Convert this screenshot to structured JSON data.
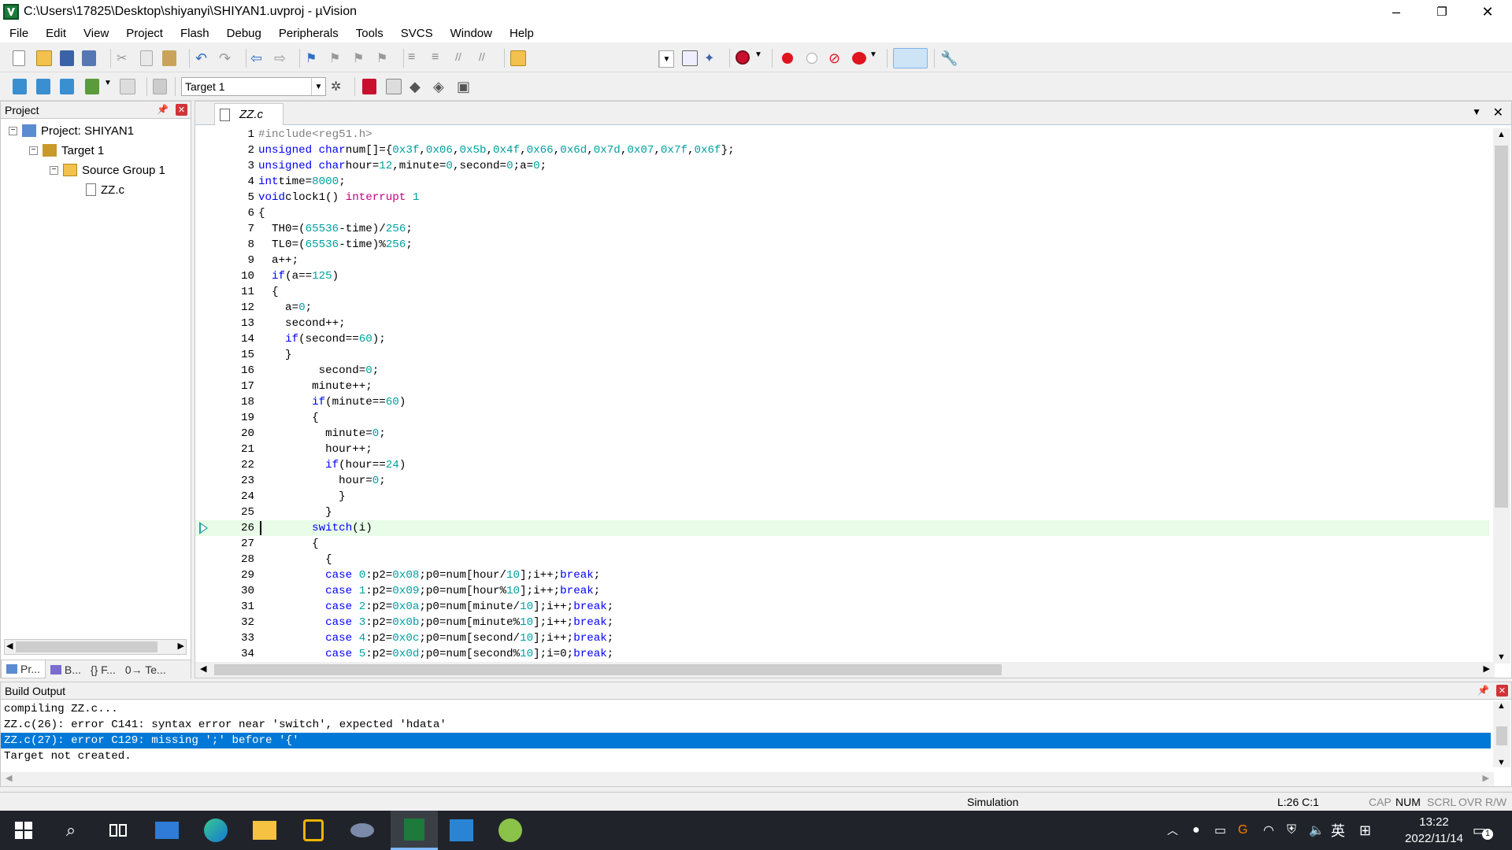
{
  "window": {
    "title": "C:\\Users\\17825\\Desktop\\shiyanyi\\SHIYAN1.uvproj - µVision",
    "minimize": "–",
    "restore": "❐",
    "close": "✕"
  },
  "menu": [
    "File",
    "Edit",
    "View",
    "Project",
    "Flash",
    "Debug",
    "Peripherals",
    "Tools",
    "SVCS",
    "Window",
    "Help"
  ],
  "toolbar": {
    "target_select": "Target 1"
  },
  "project_panel": {
    "title": "Project",
    "tree": {
      "project": "Project: SHIYAN1",
      "target": "Target 1",
      "group": "Source Group 1",
      "file": "ZZ.c"
    },
    "tabs": [
      "Pr...",
      "B...",
      "{} F...",
      "0→ Te..."
    ]
  },
  "editor": {
    "tab": "ZZ.c",
    "current_line": 26,
    "lines": [
      {
        "n": "1",
        "t": [
          [
            "pp",
            "#include<reg51.h>"
          ]
        ]
      },
      {
        "n": "2",
        "t": [
          [
            "kw",
            "unsigned char"
          ],
          [
            "",
            "num[]={"
          ],
          [
            "num",
            "0x3f"
          ],
          [
            "",
            ","
          ],
          [
            "num",
            "0x06"
          ],
          [
            "",
            ","
          ],
          [
            "num",
            "0x5b"
          ],
          [
            "",
            ","
          ],
          [
            "num",
            "0x4f"
          ],
          [
            "",
            ","
          ],
          [
            "num",
            "0x66"
          ],
          [
            "",
            ","
          ],
          [
            "num",
            "0x6d"
          ],
          [
            "",
            ","
          ],
          [
            "num",
            "0x7d"
          ],
          [
            "",
            ","
          ],
          [
            "num",
            "0x07"
          ],
          [
            "",
            ","
          ],
          [
            "num",
            "0x7f"
          ],
          [
            "",
            ","
          ],
          [
            "num",
            "0x6f"
          ],
          [
            "",
            "};"
          ]
        ]
      },
      {
        "n": "3",
        "t": [
          [
            "kw",
            "unsigned char"
          ],
          [
            "",
            "hour="
          ],
          [
            "num",
            "12"
          ],
          [
            "",
            ",minute="
          ],
          [
            "num",
            "0"
          ],
          [
            "",
            ",second="
          ],
          [
            "num",
            "0"
          ],
          [
            "",
            ";a="
          ],
          [
            "num",
            "0"
          ],
          [
            "",
            ";"
          ]
        ]
      },
      {
        "n": "4",
        "t": [
          [
            "kw",
            "int"
          ],
          [
            "",
            "time="
          ],
          [
            "num",
            "8000"
          ],
          [
            "",
            ";"
          ]
        ]
      },
      {
        "n": "5",
        "t": [
          [
            "kw",
            "void"
          ],
          [
            "",
            "clock1() "
          ],
          [
            "ib",
            "interrupt"
          ],
          [
            "num",
            " 1"
          ]
        ]
      },
      {
        "n": "6",
        "t": [
          [
            "",
            "{"
          ]
        ]
      },
      {
        "n": "7",
        "t": [
          [
            "",
            "  TH0=("
          ],
          [
            "num",
            "65536"
          ],
          [
            "",
            "-time)/"
          ],
          [
            "num",
            "256"
          ],
          [
            "",
            ";"
          ]
        ]
      },
      {
        "n": "8",
        "t": [
          [
            "",
            "  TL0=("
          ],
          [
            "num",
            "65536"
          ],
          [
            "",
            "-time)%"
          ],
          [
            "num",
            "256"
          ],
          [
            "",
            ";"
          ]
        ]
      },
      {
        "n": "9",
        "t": [
          [
            "",
            "  a++;"
          ]
        ]
      },
      {
        "n": "10",
        "t": [
          [
            "",
            "  "
          ],
          [
            "kw",
            "if"
          ],
          [
            "",
            "(a=="
          ],
          [
            "num",
            "125"
          ],
          [
            "",
            ")"
          ]
        ]
      },
      {
        "n": "11",
        "t": [
          [
            "",
            "  {"
          ]
        ]
      },
      {
        "n": "12",
        "t": [
          [
            "",
            "    a="
          ],
          [
            "num",
            "0"
          ],
          [
            "",
            ";"
          ]
        ]
      },
      {
        "n": "13",
        "t": [
          [
            "",
            "    second++;"
          ]
        ]
      },
      {
        "n": "14",
        "t": [
          [
            "",
            "    "
          ],
          [
            "kw",
            "if"
          ],
          [
            "",
            "(second=="
          ],
          [
            "num",
            "60"
          ],
          [
            "",
            ");"
          ]
        ]
      },
      {
        "n": "15",
        "t": [
          [
            "",
            "    }"
          ]
        ]
      },
      {
        "n": "16",
        "t": [
          [
            "",
            "         second="
          ],
          [
            "num",
            "0"
          ],
          [
            "",
            ";"
          ]
        ]
      },
      {
        "n": "17",
        "t": [
          [
            "",
            "        minute++;"
          ]
        ]
      },
      {
        "n": "18",
        "t": [
          [
            "",
            "        "
          ],
          [
            "kw",
            "if"
          ],
          [
            "",
            "(minute=="
          ],
          [
            "num",
            "60"
          ],
          [
            "",
            ")"
          ]
        ]
      },
      {
        "n": "19",
        "t": [
          [
            "",
            "        {"
          ]
        ]
      },
      {
        "n": "20",
        "t": [
          [
            "",
            "          minute="
          ],
          [
            "num",
            "0"
          ],
          [
            "",
            ";"
          ]
        ]
      },
      {
        "n": "21",
        "t": [
          [
            "",
            "          hour++;"
          ]
        ]
      },
      {
        "n": "22",
        "t": [
          [
            "",
            "          "
          ],
          [
            "kw",
            "if"
          ],
          [
            "",
            "(hour=="
          ],
          [
            "num",
            "24"
          ],
          [
            "",
            ")"
          ]
        ]
      },
      {
        "n": "23",
        "t": [
          [
            "",
            "            hour="
          ],
          [
            "num",
            "0"
          ],
          [
            "",
            ";"
          ]
        ]
      },
      {
        "n": "24",
        "t": [
          [
            "",
            "            }"
          ]
        ]
      },
      {
        "n": "25",
        "t": [
          [
            "",
            "          }"
          ]
        ]
      },
      {
        "n": "26",
        "t": [
          [
            "",
            "        "
          ],
          [
            "kw",
            "switch"
          ],
          [
            "",
            "(i)"
          ]
        ]
      },
      {
        "n": "27",
        "t": [
          [
            "",
            "        {"
          ]
        ]
      },
      {
        "n": "28",
        "t": [
          [
            "",
            "          {"
          ]
        ]
      },
      {
        "n": "29",
        "t": [
          [
            "",
            "          "
          ],
          [
            "kw",
            "case"
          ],
          [
            "num",
            " 0"
          ],
          [
            "",
            ":p2="
          ],
          [
            "num",
            "0x08"
          ],
          [
            "",
            ";p0=num[hour/"
          ],
          [
            "num",
            "10"
          ],
          [
            "",
            "];i++;"
          ],
          [
            "kw",
            "break"
          ],
          [
            "",
            ";"
          ]
        ]
      },
      {
        "n": "30",
        "t": [
          [
            "",
            "          "
          ],
          [
            "kw",
            "case"
          ],
          [
            "num",
            " 1"
          ],
          [
            "",
            ":p2="
          ],
          [
            "num",
            "0x09"
          ],
          [
            "",
            ";p0=num[hour%"
          ],
          [
            "num",
            "10"
          ],
          [
            "",
            "];i++;"
          ],
          [
            "kw",
            "break"
          ],
          [
            "",
            ";"
          ]
        ]
      },
      {
        "n": "31",
        "t": [
          [
            "",
            "          "
          ],
          [
            "kw",
            "case"
          ],
          [
            "num",
            " 2"
          ],
          [
            "",
            ":p2="
          ],
          [
            "num",
            "0x0a"
          ],
          [
            "",
            ";p0=num[minute/"
          ],
          [
            "num",
            "10"
          ],
          [
            "",
            "];i++;"
          ],
          [
            "kw",
            "break"
          ],
          [
            "",
            ";"
          ]
        ]
      },
      {
        "n": "32",
        "t": [
          [
            "",
            "          "
          ],
          [
            "kw",
            "case"
          ],
          [
            "num",
            " 3"
          ],
          [
            "",
            ":p2="
          ],
          [
            "num",
            "0x0b"
          ],
          [
            "",
            ";p0=num[minute%"
          ],
          [
            "num",
            "10"
          ],
          [
            "",
            "];i++;"
          ],
          [
            "kw",
            "break"
          ],
          [
            "",
            ";"
          ]
        ]
      },
      {
        "n": "33",
        "t": [
          [
            "",
            "          "
          ],
          [
            "kw",
            "case"
          ],
          [
            "num",
            " 4"
          ],
          [
            "",
            ":p2="
          ],
          [
            "num",
            "0x0c"
          ],
          [
            "",
            ";p0=num[second/"
          ],
          [
            "num",
            "10"
          ],
          [
            "",
            "];i++;"
          ],
          [
            "kw",
            "break"
          ],
          [
            "",
            ";"
          ]
        ]
      },
      {
        "n": "34",
        "t": [
          [
            "",
            "          "
          ],
          [
            "kw",
            "case"
          ],
          [
            "num",
            " 5"
          ],
          [
            "",
            ":p2="
          ],
          [
            "num",
            "0x0d"
          ],
          [
            "",
            ";p0=num[second%"
          ],
          [
            "num",
            "10"
          ],
          [
            "",
            "];i=0;"
          ],
          [
            "kw",
            "break"
          ],
          [
            "",
            ";"
          ]
        ]
      }
    ]
  },
  "build_output": {
    "title": "Build Output",
    "lines": [
      "compiling ZZ.c...",
      "ZZ.c(26): error C141: syntax error near 'switch', expected 'hdata'",
      "ZZ.c(27): error C129: missing ';' before '{'",
      "Target not created."
    ],
    "selected_index": 2
  },
  "statusbar": {
    "mode": "Simulation",
    "position": "L:26 C:1",
    "cap": "CAP",
    "num": "NUM",
    "scrl": "SCRL",
    "ovr": "OVR",
    "rw": "R/W"
  },
  "taskbar": {
    "ime": "英",
    "time": "13:22",
    "date": "2022/11/14",
    "notifications": "1"
  },
  "colors": {
    "keyword": "#0000ff",
    "number": "#00a0a0",
    "preprocessor": "#808080",
    "interrupt": "#c00080",
    "selection": "#0078d7",
    "current_line": "#e8fce8"
  }
}
